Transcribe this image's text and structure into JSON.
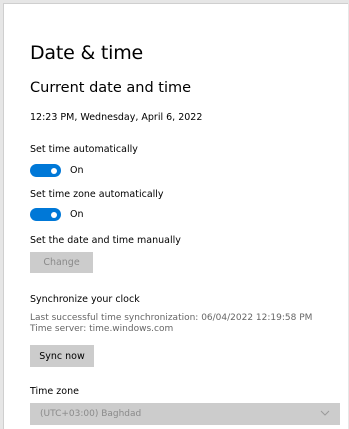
{
  "page": {
    "title": "Date & time",
    "section_heading": "Current date and time",
    "current_datetime": "12:23 PM, Wednesday, April 6, 2022"
  },
  "auto_time": {
    "label": "Set time automatically",
    "state_label": "On",
    "on": true
  },
  "auto_timezone": {
    "label": "Set time zone automatically",
    "state_label": "On",
    "on": true
  },
  "manual": {
    "label": "Set the date and time manually",
    "button_label": "Change",
    "enabled": false
  },
  "sync": {
    "heading": "Synchronize your clock",
    "last_sync": "Last successful time synchronization: 06/04/2022 12:19:58 PM",
    "server": "Time server: time.windows.com",
    "button_label": "Sync now"
  },
  "timezone": {
    "label": "Time zone",
    "selected": "(UTC+03:00) Baghdad",
    "enabled": false
  },
  "colors": {
    "accent": "#0078d7",
    "button_bg": "#cccccc",
    "disabled_text": "#8a8a8a"
  },
  "icons": {
    "dropdown": "chevron-down-icon"
  }
}
